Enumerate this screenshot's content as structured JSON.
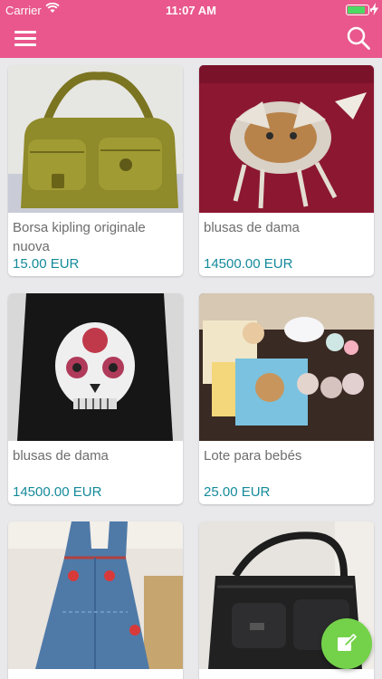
{
  "status_bar": {
    "carrier": "Carrier",
    "time": "11:07 AM",
    "battery_level": 0.9
  },
  "nav": {
    "menu_icon": "hamburger-menu-icon",
    "search_icon": "search-icon",
    "color": "#e9578c"
  },
  "listings": [
    {
      "title": "Borsa kipling originale nuova",
      "price": "15.00 EUR",
      "image": "olive-green-shoulder-bag"
    },
    {
      "title": "blusas de dama",
      "price": "14500.00 EUR",
      "image": "burgundy-top-with-dreamcatcher-print"
    },
    {
      "title": "blusas de dama",
      "price": "14500.00 EUR",
      "image": "black-top-with-sugar-skull-print"
    },
    {
      "title": "Lote para bebés",
      "price": "25.00 EUR",
      "image": "baby-blankets-and-plush-toys"
    },
    {
      "title": "",
      "price": "",
      "image": "denim-overall-dress"
    },
    {
      "title": "",
      "price": "",
      "image": "black-leather-bag"
    }
  ],
  "fab": {
    "icon": "compose-icon",
    "color": "#74d24a"
  },
  "colors": {
    "accent": "#e9578c",
    "price": "#148a9a",
    "background": "#e9e9ec"
  }
}
